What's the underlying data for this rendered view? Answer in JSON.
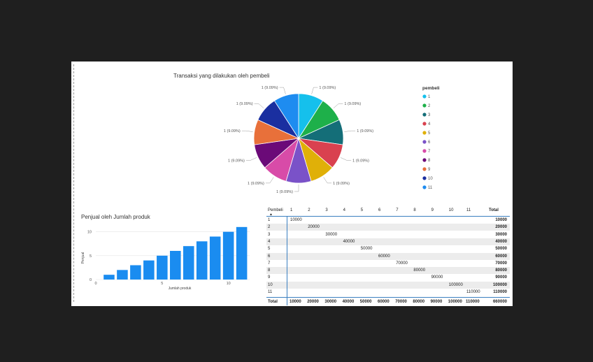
{
  "pie": {
    "title": "Transaksi yang dilakukan oleh pembeli",
    "legend_title": "pembeli",
    "slice_label": "1 (9.09%)"
  },
  "bar": {
    "title": "Penjual oleh Jumlah produk",
    "xlabel": "Jumlah produk",
    "ylabel": "Penjual",
    "color": "#1a8cf0"
  },
  "matrix": {
    "row_header": "Pembeli",
    "total_label": "Total",
    "columns": [
      "1",
      "2",
      "3",
      "4",
      "5",
      "6",
      "7",
      "8",
      "9",
      "10",
      "11"
    ],
    "rows": [
      {
        "label": "1",
        "value": "10000",
        "total": "10000"
      },
      {
        "label": "2",
        "value": "20000",
        "total": "20000"
      },
      {
        "label": "3",
        "value": "30000",
        "total": "30000"
      },
      {
        "label": "4",
        "value": "40000",
        "total": "40000"
      },
      {
        "label": "5",
        "value": "50000",
        "total": "50000"
      },
      {
        "label": "6",
        "value": "60000",
        "total": "60000"
      },
      {
        "label": "7",
        "value": "70000",
        "total": "70000"
      },
      {
        "label": "8",
        "value": "80000",
        "total": "80000"
      },
      {
        "label": "9",
        "value": "90000",
        "total": "90000"
      },
      {
        "label": "10",
        "value": "100000",
        "total": "100000"
      },
      {
        "label": "11",
        "value": "110000",
        "total": "110000"
      }
    ],
    "totals": [
      "10000",
      "20000",
      "30000",
      "40000",
      "50000",
      "60000",
      "70000",
      "80000",
      "90000",
      "100000",
      "110000"
    ],
    "grand_total": "660000"
  },
  "chart_data": [
    {
      "type": "pie",
      "title": "Transaksi yang dilakukan oleh pembeli",
      "legend_title": "pembeli",
      "legend_placement": "right",
      "categories": [
        "1",
        "2",
        "3",
        "4",
        "5",
        "6",
        "7",
        "8",
        "9",
        "10",
        "11"
      ],
      "values": [
        1,
        1,
        1,
        1,
        1,
        1,
        1,
        1,
        1,
        1,
        1
      ],
      "labels": [
        "1 (9.09%)",
        "1 (9.09%)",
        "1 (9.09%)",
        "1 (9.09%)",
        "1 (9.09%)",
        "1 (9.09%)",
        "1 (9.09%)",
        "1 (9.09%)",
        "1 (9.09%)",
        "1 (9.09%)",
        "1 (9.09%)"
      ],
      "colors": [
        "#15c0ec",
        "#1eb04a",
        "#146e78",
        "#d9414f",
        "#e0b008",
        "#7a52c8",
        "#d84ba8",
        "#6b0a78",
        "#e8703a",
        "#1a2fa0",
        "#1e8cf0"
      ]
    },
    {
      "type": "bar",
      "title": "Penjual oleh Jumlah produk",
      "xlabel": "Jumlah produk",
      "ylabel": "Penjual",
      "x": [
        1,
        2,
        3,
        4,
        5,
        6,
        7,
        8,
        9,
        10,
        11
      ],
      "values": [
        1,
        2,
        3,
        4,
        5,
        6,
        7,
        8,
        9,
        10,
        11
      ],
      "xlim": [
        0,
        11.6
      ],
      "ylim": [
        0,
        12
      ],
      "xticks": [
        0,
        5,
        10
      ],
      "yticks": [
        0,
        5,
        10
      ],
      "grid": true
    },
    {
      "type": "table",
      "title": "",
      "columns": [
        "1",
        "2",
        "3",
        "4",
        "5",
        "6",
        "7",
        "8",
        "9",
        "10",
        "11",
        "Total"
      ],
      "rows": [
        "1",
        "2",
        "3",
        "4",
        "5",
        "6",
        "7",
        "8",
        "9",
        "10",
        "11",
        "Total"
      ],
      "diagonal_values": [
        10000,
        20000,
        30000,
        40000,
        50000,
        60000,
        70000,
        80000,
        90000,
        100000,
        110000
      ],
      "grand_total": 660000
    }
  ]
}
